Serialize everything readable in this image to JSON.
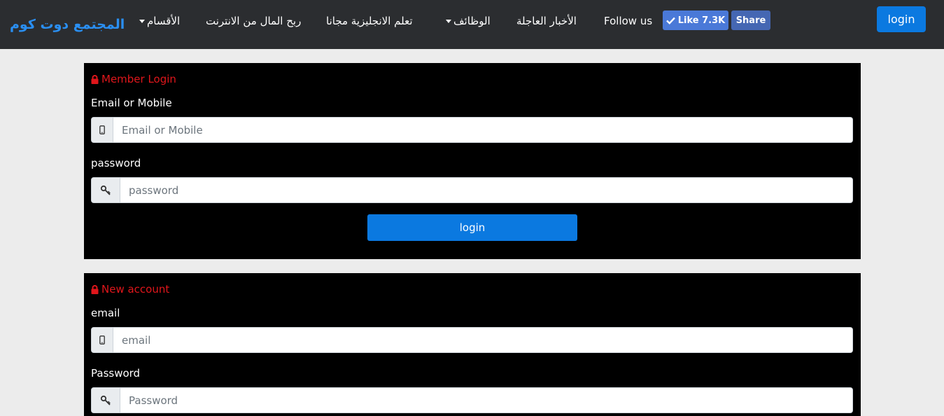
{
  "navbar": {
    "brand": "المجتمع دوت كوم",
    "items": [
      {
        "label": "الأقسام"
      },
      {
        "label": "ربح المال من الانترنت"
      },
      {
        "label": "تعلم الانجليزية مجانا"
      },
      {
        "label": "الوظائف"
      },
      {
        "label": "الأخبار العاجلة"
      },
      {
        "label": "Follow us"
      }
    ],
    "facebook": {
      "like_label": "Like 7.3K",
      "share_label": "Share"
    },
    "login_label": "login"
  },
  "login_form": {
    "title": "Member Login",
    "email_label": "Email or Mobile",
    "email_placeholder": "Email or Mobile",
    "password_label": "password",
    "password_placeholder": "password",
    "submit_label": "login"
  },
  "signup_form": {
    "title": "New account",
    "email_label": "email",
    "email_placeholder": "email",
    "password_label": "Password",
    "password_placeholder": "Password"
  },
  "colors": {
    "accent": "#0b79e0",
    "brand": "#2a8ff2",
    "title_red": "#e0161b",
    "navbar_bg": "#2b2d30",
    "panel_bg": "#000000"
  }
}
